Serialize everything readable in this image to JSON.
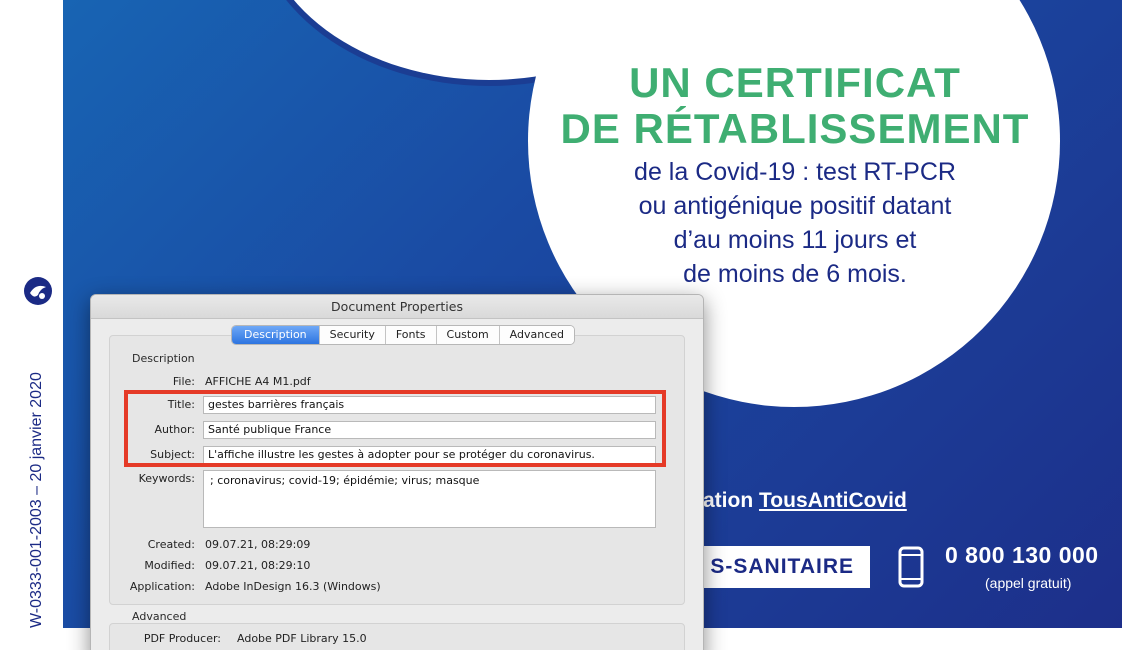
{
  "poster": {
    "headline_line1": "UN CERTIFICAT",
    "headline_line2": "DE RÉTABLISSEMENT",
    "subtext_lines": [
      "de la Covid-19 : test RT-PCR",
      "ou antigénique positif datant",
      "d’au moins 11 jours et",
      "de moins de 6 mois."
    ],
    "app_prefix": "ation",
    "app_name": "TousAntiCovid",
    "box_text": "S-SANITAIRE",
    "phone_number": "0 800 130 000",
    "phone_note": "(appel gratuit)",
    "vertical_ref": "W-0333-001-2003 – 20 janvier 2020",
    "colors": {
      "blue": "#1a4aa3",
      "green": "#3fae72",
      "navy": "#1b2a85"
    }
  },
  "dialog": {
    "title": "Document Properties",
    "tabs": [
      {
        "label": "Description",
        "active": true
      },
      {
        "label": "Security",
        "active": false
      },
      {
        "label": "Fonts",
        "active": false
      },
      {
        "label": "Custom",
        "active": false
      },
      {
        "label": "Advanced",
        "active": false
      }
    ],
    "description_section": "Description",
    "file_label": "File:",
    "file_value": "AFFICHE A4 M1.pdf",
    "title_label": "Title:",
    "title_value": "gestes barrières français",
    "author_label": "Author:",
    "author_value": "Santé publique France",
    "subject_label": "Subject:",
    "subject_value": "L'affiche illustre les gestes à adopter pour se protéger du coronavirus.",
    "keywords_label": "Keywords:",
    "keywords_value": "; coronavirus; covid-19; épidémie; virus; masque",
    "created_label": "Created:",
    "created_value": "09.07.21, 08:29:09",
    "modified_label": "Modified:",
    "modified_value": "09.07.21, 08:29:10",
    "application_label": "Application:",
    "application_value": "Adobe InDesign 16.3 (Windows)",
    "advanced_section": "Advanced",
    "producer_label": "PDF Producer:",
    "producer_value": "Adobe PDF Library 15.0"
  }
}
